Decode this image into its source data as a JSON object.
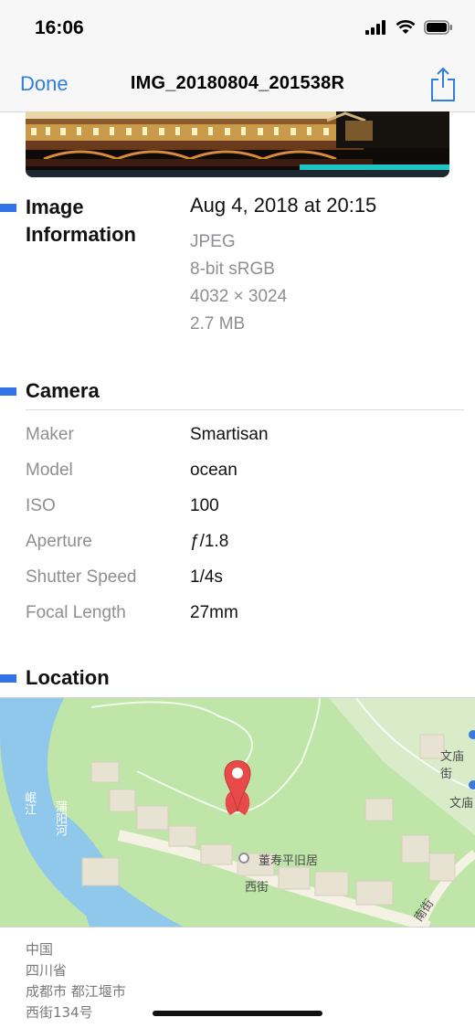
{
  "status": {
    "time": "16:06"
  },
  "nav": {
    "done_label": "Done",
    "title": "IMG_20180804_201538R"
  },
  "image_info": {
    "title_line1": "Image",
    "title_line2": "Information",
    "date": "Aug 4, 2018 at 20:15",
    "format": "JPEG",
    "color_profile": "8-bit sRGB",
    "dimensions": "4032 × 3024",
    "size": "2.7 MB"
  },
  "camera": {
    "title": "Camera",
    "rows": [
      {
        "key": "Maker",
        "value": "Smartisan"
      },
      {
        "key": "Model",
        "value": "ocean"
      },
      {
        "key": "ISO",
        "value": "100"
      },
      {
        "key": "Aperture",
        "value": "ƒ/1.8"
      },
      {
        "key": "Shutter Speed",
        "value": "1/4s"
      },
      {
        "key": "Focal Length",
        "value": "27mm"
      }
    ]
  },
  "location": {
    "title": "Location",
    "map_labels": {
      "river1": "岷江",
      "river2": "蒲阳河",
      "poi": "董寿平旧居",
      "street1": "西街",
      "street2": "南街",
      "temple1": "文庙街",
      "temple2": "文庙"
    },
    "address": [
      "中国",
      "四川省",
      "成都市 都江堰市",
      "西街134号"
    ]
  },
  "colors": {
    "accent": "#2f7fe0",
    "section_marker": "#2f73e6",
    "map_green": "#b9e3a3",
    "map_water": "#8fc8ea",
    "pin": "#e84a4a"
  }
}
